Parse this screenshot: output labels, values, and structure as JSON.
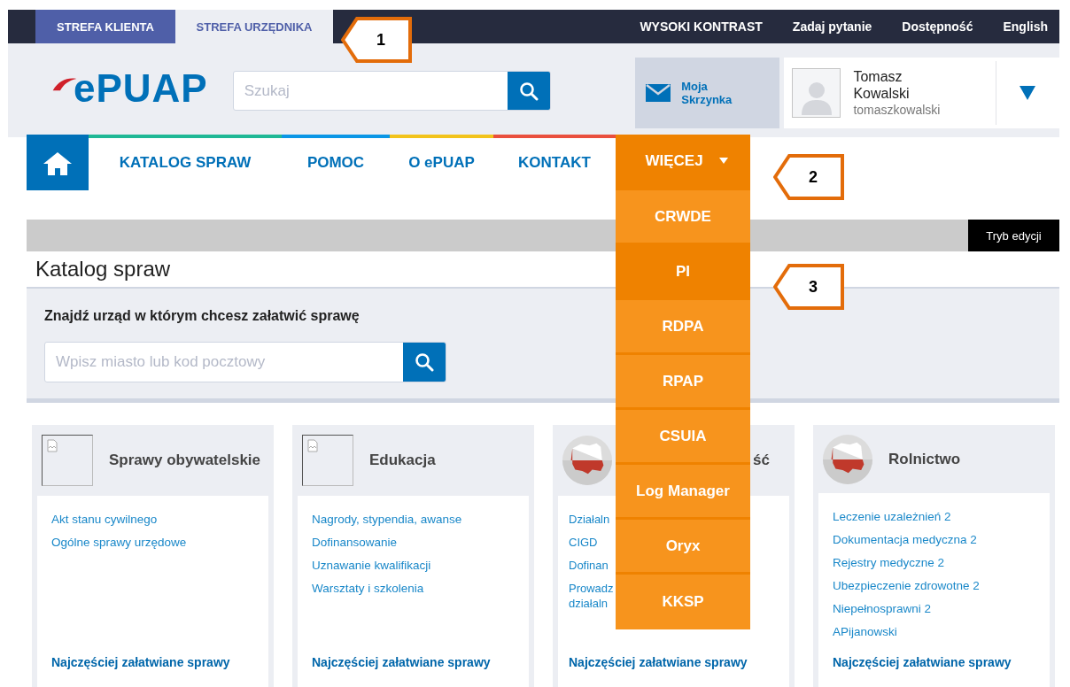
{
  "top_bar": {
    "zones": [
      {
        "label": "STREFA KLIENTA",
        "selected": false
      },
      {
        "label": "STREFA URZĘDNIKA",
        "selected": true
      }
    ],
    "links": [
      "WYSOKI KONTRAST",
      "Zadaj pytanie",
      "Dostępność",
      "English"
    ]
  },
  "header": {
    "logo": "ePUAP",
    "search": {
      "placeholder": "Szukaj"
    },
    "mailbox": "Moja Skrzynka",
    "user": {
      "name": "Tomasz Kowalski",
      "login": "tomaszkowalski"
    }
  },
  "nav": {
    "items": [
      {
        "label": "KATALOG SPRAW",
        "color": "#1fb895"
      },
      {
        "label": "POMOC",
        "color": "#0a96e6"
      },
      {
        "label": "O ePUAP",
        "color": "#f2c31a"
      },
      {
        "label": "KONTAKT",
        "color": "#ea4f3d"
      }
    ],
    "more": {
      "label": "WIĘCEJ",
      "expanded": true,
      "items": [
        {
          "label": "CRWDE",
          "selected": false
        },
        {
          "label": "PI",
          "selected": true
        },
        {
          "label": "RDPA",
          "selected": false
        },
        {
          "label": "RPAP",
          "selected": false
        },
        {
          "label": "CSUIA",
          "selected": false
        },
        {
          "label": "Log Manager",
          "selected": false
        },
        {
          "label": "Oryx",
          "selected": false
        },
        {
          "label": "KKSP",
          "selected": false
        }
      ]
    }
  },
  "edit_mode": "Tryb edycji",
  "page_title": "Katalog spraw",
  "office_search": {
    "label": "Znajdź urząd w którym chcesz załatwić sprawę",
    "placeholder": "Wpisz miasto lub kod pocztowy"
  },
  "cards": [
    {
      "kind": "placeholder",
      "title": "Sprawy obywatelskie",
      "links": [
        "Akt stanu cywilnego",
        "Ogólne sprawy urzędowe"
      ],
      "footer": "Najczęściej załatwiane sprawy"
    },
    {
      "kind": "placeholder",
      "title": "Edukacja",
      "links": [
        "Nagrody, stypendia, awanse",
        "Dofinansowanie",
        "Uznawanie kwalifikacji",
        "Warsztaty i szkolenia"
      ],
      "footer": "Najczęściej załatwiane sprawy"
    },
    {
      "kind": "covered",
      "title": "ść",
      "links": [
        "Działaln",
        "CIGD",
        "Dofinan",
        "Prowadz działaln"
      ],
      "footer": "Najczęściej załatwiane sprawy"
    },
    {
      "kind": "map",
      "title": "Rolnictwo",
      "links": [
        "Leczenie uzależnień 2",
        "Dokumentacja medyczna 2",
        "Rejestry medyczne 2",
        "Ubezpieczenie zdrowotne 2",
        "Niepełnosprawni 2",
        "APijanowski"
      ],
      "footer": "Najczęściej załatwiane sprawy"
    }
  ],
  "callouts": [
    {
      "number": "1"
    },
    {
      "number": "2"
    },
    {
      "number": "3"
    }
  ]
}
